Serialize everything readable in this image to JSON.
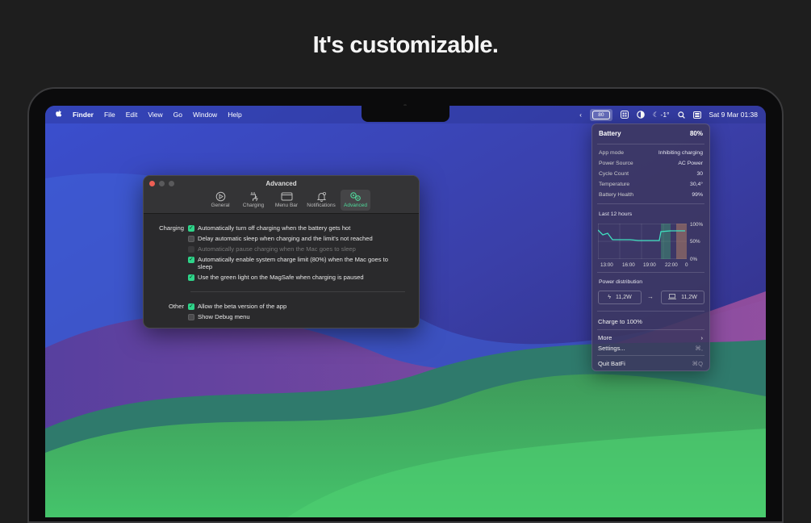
{
  "headline": "It's customizable.",
  "menubar": {
    "apple": "",
    "app": "Finder",
    "menus": [
      "File",
      "Edit",
      "View",
      "Go",
      "Window",
      "Help"
    ],
    "battery_percent": "80",
    "weather": "-1°",
    "date_time": "Sat 9 Mar  01:38"
  },
  "settings_window": {
    "title": "Advanced",
    "tabs": [
      {
        "label": "General",
        "icon": "play-circle-icon"
      },
      {
        "label": "Charging",
        "icon": "plug-bolt-icon"
      },
      {
        "label": "Menu Bar",
        "icon": "menubar-icon"
      },
      {
        "label": "Notifications",
        "icon": "bell-icon"
      },
      {
        "label": "Advanced",
        "icon": "gears-icon",
        "selected": true
      }
    ],
    "charging_label": "Charging",
    "charging_options": [
      {
        "label": "Automatically turn off charging when the battery gets hot",
        "checked": true,
        "disabled": false
      },
      {
        "label": "Delay automatic sleep when charging and the limit's not reached",
        "checked": false,
        "disabled": false
      },
      {
        "label": "Automatically pause charging when the Mac goes to sleep",
        "checked": false,
        "disabled": true
      },
      {
        "label": "Automatically enable system charge limit (80%) when the Mac goes to sleep",
        "checked": true,
        "disabled": false
      },
      {
        "label": "Use the green light on the MagSafe when charging is paused",
        "checked": true,
        "disabled": false
      }
    ],
    "other_label": "Other",
    "other_options": [
      {
        "label": "Allow the beta version of the app",
        "checked": true
      },
      {
        "label": "Show Debug menu",
        "checked": false
      }
    ]
  },
  "battery_popover": {
    "title": "Battery",
    "percent": "80%",
    "details": [
      {
        "key": "App mode",
        "value": "Inhibiting charging"
      },
      {
        "key": "Power Source",
        "value": "AC Power"
      },
      {
        "key": "Cycle Count",
        "value": "30"
      },
      {
        "key": "Temperature",
        "value": "30,4°"
      },
      {
        "key": "Battery Health",
        "value": "99%"
      }
    ],
    "history_title": "Last 12 hours",
    "y_ticks": [
      "100%",
      "50%",
      "0%"
    ],
    "x_ticks": [
      "13:00",
      "16:00",
      "19:00",
      "22:00",
      "0"
    ],
    "power_title": "Power distribution",
    "power_in": "11,2W",
    "power_out": "11,2W",
    "charge_action": "Charge to 100%",
    "more": "More",
    "settings": "Settings...",
    "settings_shortcut": "⌘,",
    "quit": "Quit BatFi",
    "quit_shortcut": "⌘Q"
  },
  "colors": {
    "accent_green": "#2fd58a",
    "close_red": "#ed5f55",
    "popover_bg": "#3c375f"
  }
}
